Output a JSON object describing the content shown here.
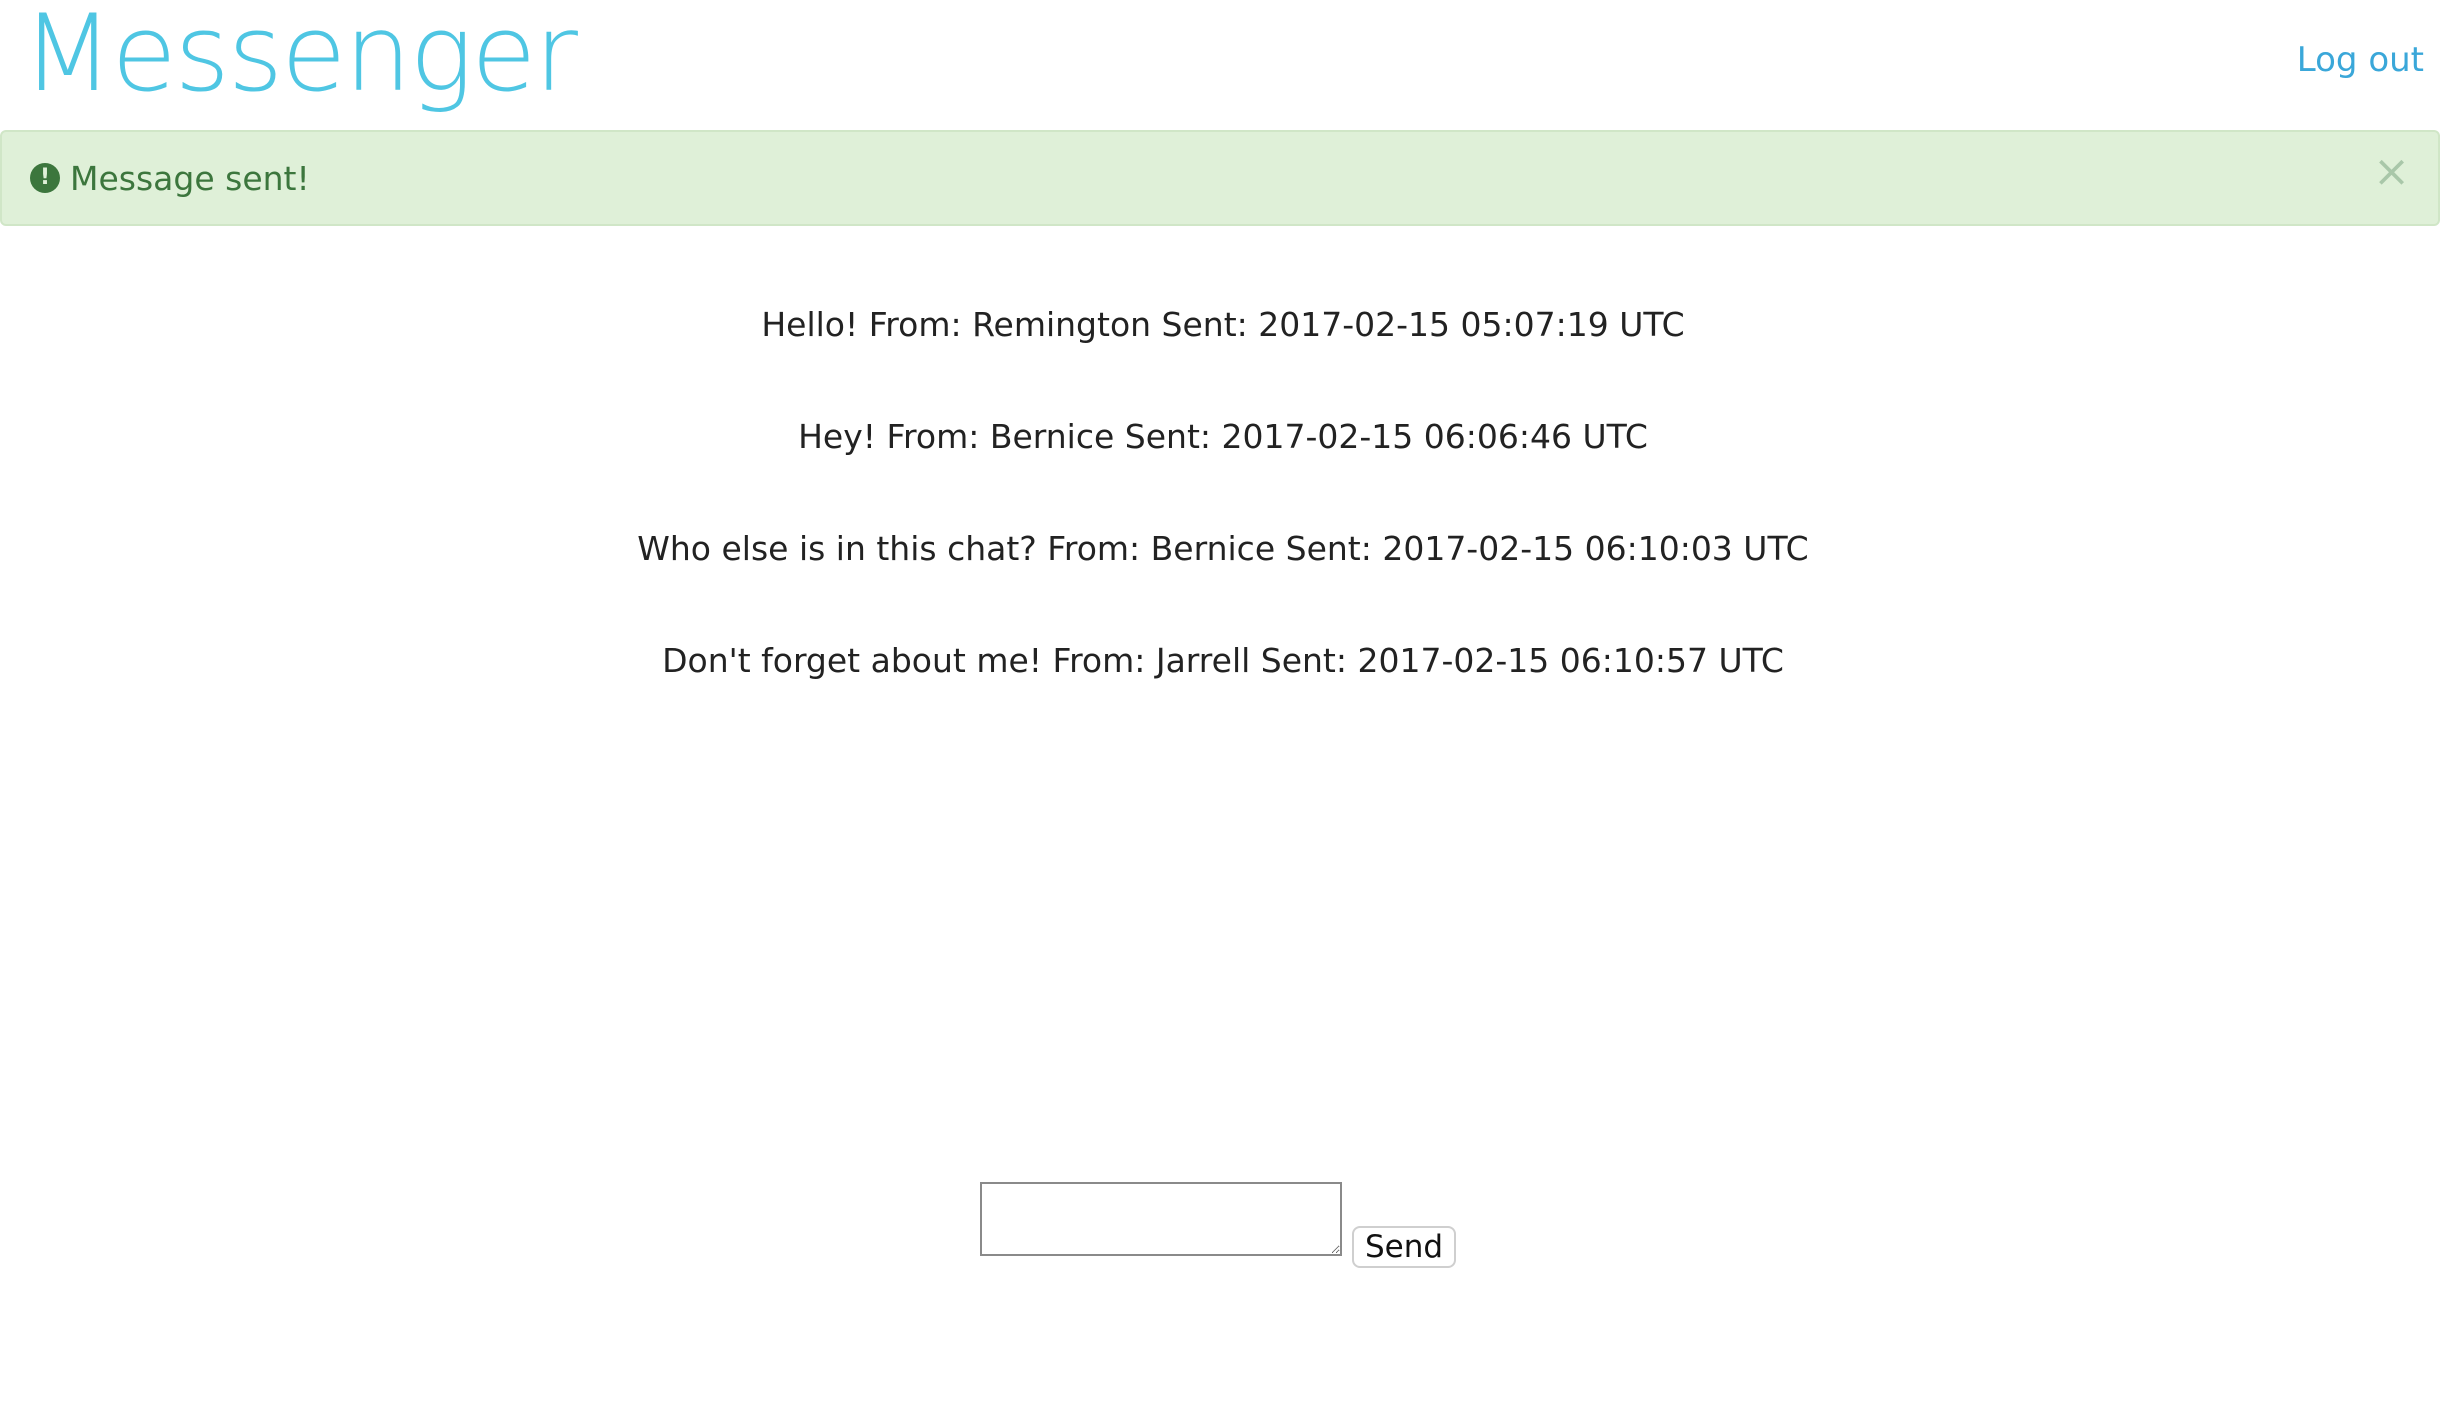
{
  "header": {
    "logo": "Messenger",
    "logout_label": "Log out"
  },
  "alert": {
    "icon": "exclamation-circle-icon",
    "text": "Message sent!",
    "close_glyph": "×"
  },
  "messages": [
    {
      "text": "Hello! From: Remington Sent: 2017-02-15 05:07:19 UTC"
    },
    {
      "text": "Hey! From: Bernice Sent: 2017-02-15 06:06:46 UTC"
    },
    {
      "text": "Who else is in this chat? From: Bernice Sent: 2017-02-15 06:10:03 UTC"
    },
    {
      "text": "Don't forget about me! From: Jarrell Sent: 2017-02-15 06:10:57 UTC"
    }
  ],
  "compose": {
    "input_value": "",
    "send_label": "Send"
  },
  "colors": {
    "brand": "#4fc6e3",
    "link": "#3aa7d9",
    "alert_bg": "#dff0d8",
    "alert_text": "#3c763d"
  }
}
